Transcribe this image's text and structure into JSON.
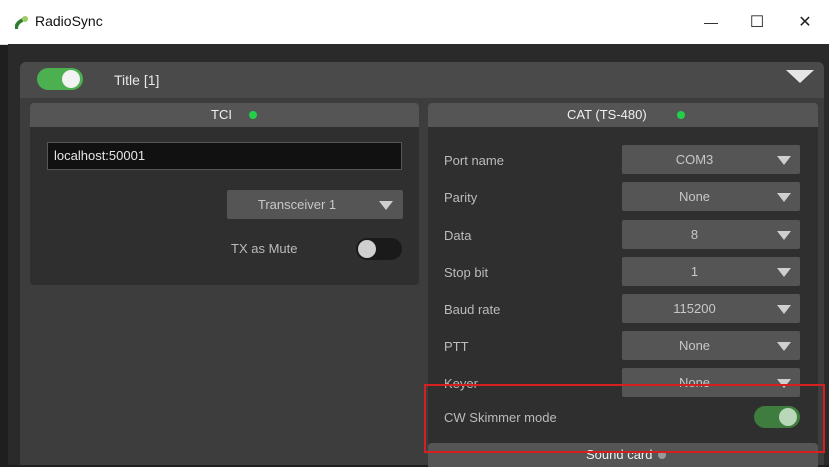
{
  "window": {
    "title": "RadioSync",
    "controls": {
      "minimize": "—",
      "maximize": "☐",
      "close": "✕"
    }
  },
  "section": {
    "title": "Title [1]",
    "enabled": true
  },
  "tci": {
    "title": "TCI",
    "address": "localhost:50001",
    "transceiver": "Transceiver 1",
    "tx_as_mute_label": "TX as Mute",
    "tx_as_mute": false
  },
  "cat": {
    "title": "CAT (TS-480)",
    "rows": [
      {
        "label": "Port name",
        "value": "COM3"
      },
      {
        "label": "Parity",
        "value": "None"
      },
      {
        "label": "Data",
        "value": "8"
      },
      {
        "label": "Stop bit",
        "value": "1"
      },
      {
        "label": "Baud rate",
        "value": "115200"
      },
      {
        "label": "PTT",
        "value": "None"
      },
      {
        "label": "Keyer",
        "value": "None"
      }
    ],
    "cw_skimmer_label": "CW Skimmer mode",
    "cw_skimmer": true
  },
  "sound_card": {
    "title": "Sound card"
  },
  "colors": {
    "status_on": "#22d04a",
    "toggle_on": "#4caf50",
    "highlight": "#d42020"
  }
}
